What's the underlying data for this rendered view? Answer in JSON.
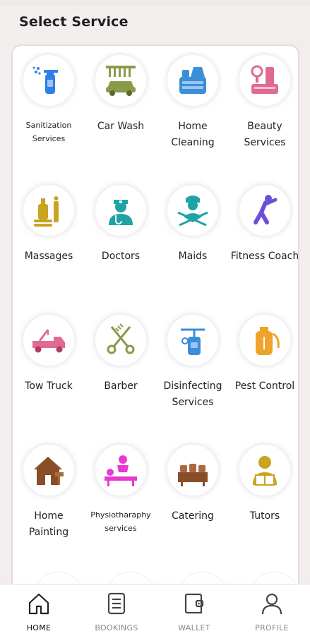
{
  "header": {
    "title": "Select Service"
  },
  "services": [
    {
      "label": "Sanitization Services",
      "icon": "spray-bottle-icon"
    },
    {
      "label": "Car Wash",
      "icon": "car-wash-icon"
    },
    {
      "label": "Home Cleaning",
      "icon": "cleaning-supplies-icon"
    },
    {
      "label": "Beauty Services",
      "icon": "makeup-icon"
    },
    {
      "label": "Massages",
      "icon": "massage-oil-icon"
    },
    {
      "label": "Doctors",
      "icon": "doctor-icon"
    },
    {
      "label": "Maids",
      "icon": "maid-icon"
    },
    {
      "label": "Fitness Coach",
      "icon": "fitness-icon"
    },
    {
      "label": "Tow Truck",
      "icon": "tow-truck-icon"
    },
    {
      "label": "Barber",
      "icon": "scissors-comb-icon"
    },
    {
      "label": "Disinfecting Services",
      "icon": "sprayer-icon"
    },
    {
      "label": "Pest Control",
      "icon": "pest-sprayer-icon"
    },
    {
      "label": "Home Painting",
      "icon": "paint-house-icon"
    },
    {
      "label": "Physiotharaphy services",
      "icon": "physiotherapy-icon"
    },
    {
      "label": "Catering",
      "icon": "catering-icon"
    },
    {
      "label": "Tutors",
      "icon": "tutor-icon"
    }
  ],
  "nav": {
    "home": "HOME",
    "bookings": "BOOKINGS",
    "wallet": "WALLET",
    "profile": "PROFILE"
  },
  "colors": {
    "blue": "#2f7fe6",
    "olive": "#8a9a4a",
    "teal": "#1fa3a3",
    "pink": "#e06a94",
    "gold": "#c8a51e",
    "purple": "#6a4fd8",
    "brown": "#8a4d2a",
    "magenta": "#e83ad0",
    "orange": "#f0a32a"
  }
}
